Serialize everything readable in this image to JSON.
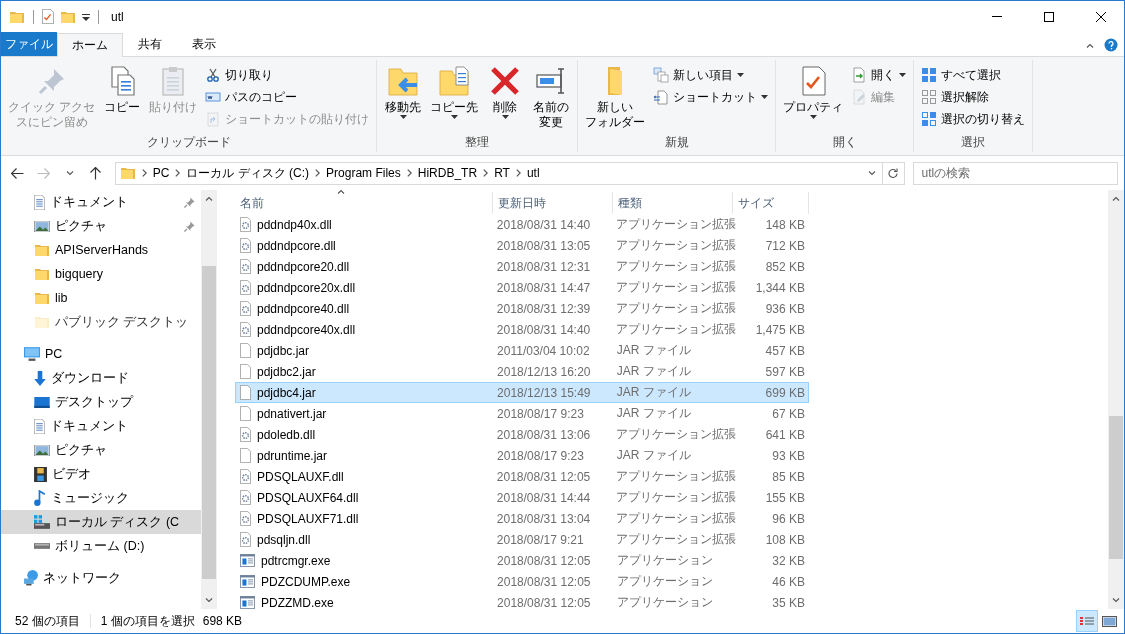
{
  "window": {
    "title": "utl"
  },
  "ribbon_tabs": [
    {
      "label": "ファイル",
      "kind": "file",
      "selected": false
    },
    {
      "label": "ホーム",
      "kind": "tab",
      "selected": true
    },
    {
      "label": "共有",
      "kind": "tab",
      "selected": false
    },
    {
      "label": "表示",
      "kind": "tab",
      "selected": false
    }
  ],
  "ribbon_groups": [
    {
      "label": "クリップボード",
      "commands": [
        {
          "lines": [
            "クイック アクセ",
            "スにピン留め"
          ],
          "kind": "large",
          "disabled": true,
          "dropdown": false
        },
        {
          "lines": [
            "コピー"
          ],
          "kind": "large",
          "disabled": false,
          "dropdown": false
        },
        {
          "lines": [
            "貼り付け"
          ],
          "kind": "large",
          "disabled": true,
          "dropdown": false
        },
        {
          "lines": [
            "切り取り"
          ],
          "kind": "small",
          "disabled": false,
          "dropdown": false
        },
        {
          "lines": [
            "パスのコピー"
          ],
          "kind": "small",
          "disabled": false,
          "dropdown": false
        },
        {
          "lines": [
            "ショートカットの貼り付け"
          ],
          "kind": "small",
          "disabled": true,
          "dropdown": false
        }
      ]
    },
    {
      "label": "整理",
      "commands": [
        {
          "lines": [
            "移動先"
          ],
          "kind": "large",
          "disabled": false,
          "dropdown": true
        },
        {
          "lines": [
            "コピー先"
          ],
          "kind": "large",
          "disabled": false,
          "dropdown": true
        },
        {
          "lines": [
            "削除"
          ],
          "kind": "large",
          "disabled": false,
          "dropdown": true
        },
        {
          "lines": [
            "名前の",
            "変更"
          ],
          "kind": "large",
          "disabled": false,
          "dropdown": false
        }
      ]
    },
    {
      "label": "新規",
      "commands": [
        {
          "lines": [
            "新しい",
            "フォルダー"
          ],
          "kind": "large",
          "disabled": false,
          "dropdown": false
        },
        {
          "lines": [
            "新しい項目"
          ],
          "kind": "small",
          "disabled": false,
          "dropdown": true
        },
        {
          "lines": [
            "ショートカット"
          ],
          "kind": "small",
          "disabled": false,
          "dropdown": true
        }
      ]
    },
    {
      "label": "開く",
      "commands": [
        {
          "lines": [
            "プロパティ"
          ],
          "kind": "large",
          "disabled": false,
          "dropdown": true
        },
        {
          "lines": [
            "開く"
          ],
          "kind": "small",
          "disabled": false,
          "dropdown": true
        },
        {
          "lines": [
            "編集"
          ],
          "kind": "small",
          "disabled": true,
          "dropdown": false
        }
      ]
    },
    {
      "label": "選択",
      "commands": [
        {
          "lines": [
            "すべて選択"
          ],
          "kind": "small",
          "disabled": false,
          "dropdown": false
        },
        {
          "lines": [
            "選択解除"
          ],
          "kind": "small",
          "disabled": false,
          "dropdown": false
        },
        {
          "lines": [
            "選択の切り替え"
          ],
          "kind": "small",
          "disabled": false,
          "dropdown": false
        }
      ]
    }
  ],
  "address": {
    "segments": [
      "PC",
      "ローカル ディスク (C:)",
      "Program Files",
      "HiRDB_TR",
      "RT",
      "utl"
    ],
    "search_placeholder": "utlの検索"
  },
  "navigation": {
    "quick_access": [
      {
        "label": "ドキュメント",
        "kind": "document",
        "pinned": true,
        "selected": false,
        "dimmed": false
      },
      {
        "label": "ピクチャ",
        "kind": "picture",
        "pinned": true,
        "selected": false,
        "dimmed": false
      },
      {
        "label": "APIServerHands",
        "kind": "folder",
        "pinned": false,
        "selected": false,
        "dimmed": false
      },
      {
        "label": "bigquery",
        "kind": "folder",
        "pinned": false,
        "selected": false,
        "dimmed": false
      },
      {
        "label": "lib",
        "kind": "folder",
        "pinned": false,
        "selected": false,
        "dimmed": false
      },
      {
        "label": "パブリック デスクトッ",
        "kind": "folder",
        "pinned": false,
        "selected": false,
        "dimmed": true
      }
    ],
    "tree": [
      {
        "label": "PC",
        "kind": "pc",
        "selected": false,
        "children": [
          {
            "label": "ダウンロード",
            "kind": "download",
            "selected": false
          },
          {
            "label": "デスクトップ",
            "kind": "desktop",
            "selected": false
          },
          {
            "label": "ドキュメント",
            "kind": "document",
            "selected": false
          },
          {
            "label": "ピクチャ",
            "kind": "picture",
            "selected": false
          },
          {
            "label": "ビデオ",
            "kind": "video",
            "selected": false
          },
          {
            "label": "ミュージック",
            "kind": "music",
            "selected": false
          },
          {
            "label": "ローカル ディスク (C",
            "kind": "drive",
            "selected": true
          },
          {
            "label": "ボリューム (D:)",
            "kind": "volume",
            "selected": false
          }
        ]
      },
      {
        "label": "ネットワーク",
        "kind": "network",
        "selected": false
      }
    ]
  },
  "files": {
    "columns": [
      "名前",
      "更新日時",
      "種類",
      "サイズ"
    ],
    "rows": [
      {
        "name": "pddndp40x.dll",
        "date": "2018/08/31 14:40",
        "type": "アプリケーション拡張",
        "size": "148 KB",
        "kind": "dll",
        "selected": false
      },
      {
        "name": "pddndpcore.dll",
        "date": "2018/08/31 13:05",
        "type": "アプリケーション拡張",
        "size": "712 KB",
        "kind": "dll",
        "selected": false
      },
      {
        "name": "pddndpcore20.dll",
        "date": "2018/08/31 12:31",
        "type": "アプリケーション拡張",
        "size": "852 KB",
        "kind": "dll",
        "selected": false
      },
      {
        "name": "pddndpcore20x.dll",
        "date": "2018/08/31 14:47",
        "type": "アプリケーション拡張",
        "size": "1,344 KB",
        "kind": "dll",
        "selected": false
      },
      {
        "name": "pddndpcore40.dll",
        "date": "2018/08/31 12:39",
        "type": "アプリケーション拡張",
        "size": "936 KB",
        "kind": "dll",
        "selected": false
      },
      {
        "name": "pddndpcore40x.dll",
        "date": "2018/08/31 14:40",
        "type": "アプリケーション拡張",
        "size": "1,475 KB",
        "kind": "dll",
        "selected": false
      },
      {
        "name": "pdjdbc.jar",
        "date": "2011/03/04 10:02",
        "type": "JAR ファイル",
        "size": "457 KB",
        "kind": "jar",
        "selected": false
      },
      {
        "name": "pdjdbc2.jar",
        "date": "2018/12/13 16:20",
        "type": "JAR ファイル",
        "size": "597 KB",
        "kind": "jar",
        "selected": false
      },
      {
        "name": "pdjdbc4.jar",
        "date": "2018/12/13 15:49",
        "type": "JAR ファイル",
        "size": "699 KB",
        "kind": "jar",
        "selected": true
      },
      {
        "name": "pdnativert.jar",
        "date": "2018/08/17 9:23",
        "type": "JAR ファイル",
        "size": "67 KB",
        "kind": "jar",
        "selected": false
      },
      {
        "name": "pdoledb.dll",
        "date": "2018/08/31 13:06",
        "type": "アプリケーション拡張",
        "size": "641 KB",
        "kind": "dll",
        "selected": false
      },
      {
        "name": "pdruntime.jar",
        "date": "2018/08/17 9:23",
        "type": "JAR ファイル",
        "size": "93 KB",
        "kind": "jar",
        "selected": false
      },
      {
        "name": "PDSQLAUXF.dll",
        "date": "2018/08/31 12:05",
        "type": "アプリケーション拡張",
        "size": "85 KB",
        "kind": "dll",
        "selected": false
      },
      {
        "name": "PDSQLAUXF64.dll",
        "date": "2018/08/31 14:44",
        "type": "アプリケーション拡張",
        "size": "155 KB",
        "kind": "dll",
        "selected": false
      },
      {
        "name": "PDSQLAUXF71.dll",
        "date": "2018/08/31 13:04",
        "type": "アプリケーション拡張",
        "size": "96 KB",
        "kind": "dll",
        "selected": false
      },
      {
        "name": "pdsqljn.dll",
        "date": "2018/08/17 9:21",
        "type": "アプリケーション拡張",
        "size": "108 KB",
        "kind": "dll",
        "selected": false
      },
      {
        "name": "pdtrcmgr.exe",
        "date": "2018/08/31 12:05",
        "type": "アプリケーション",
        "size": "32 KB",
        "kind": "exe",
        "selected": false
      },
      {
        "name": "PDZCDUMP.exe",
        "date": "2018/08/31 12:05",
        "type": "アプリケーション",
        "size": "46 KB",
        "kind": "exe",
        "selected": false
      },
      {
        "name": "PDZZMD.exe",
        "date": "2018/08/31 12:05",
        "type": "アプリケーション",
        "size": "35 KB",
        "kind": "exe",
        "selected": false
      }
    ]
  },
  "status_bar": {
    "item_count": "52 個の項目",
    "selection": "1 個の項目を選択",
    "selection_size": "698 KB",
    "views": [
      {
        "kind": "details",
        "selected": true
      },
      {
        "kind": "large_icons",
        "selected": false
      }
    ]
  }
}
